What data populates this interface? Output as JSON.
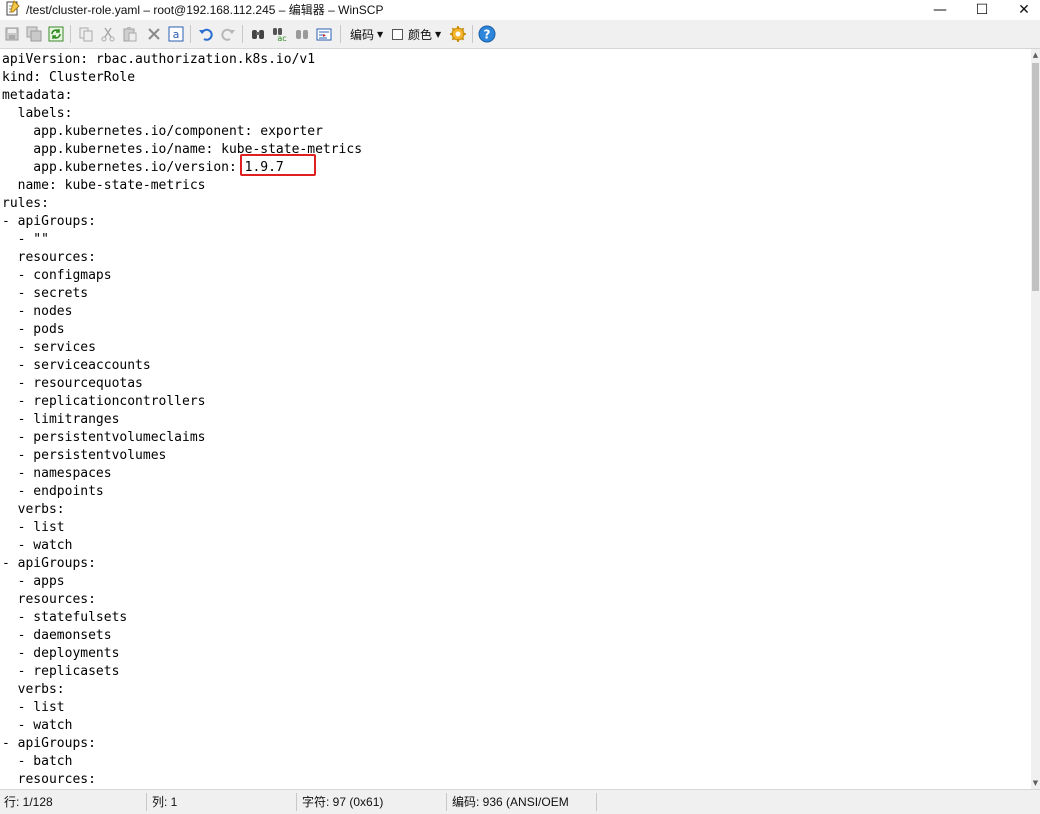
{
  "window": {
    "title": "/test/cluster-role.yaml – root@192.168.112.245 – 编辑器 – WinSCP",
    "minimize_glyph": "—",
    "maximize_glyph": "☐",
    "close_glyph": "✕"
  },
  "toolbar": {
    "encoding_label": "编码",
    "color_label": "颜色",
    "icons": [
      "save-icon",
      "save-all-icon",
      "reload-icon",
      "copy-icon",
      "cut-icon",
      "paste-icon",
      "delete-icon",
      "select-all-icon",
      "undo-icon",
      "redo-icon",
      "find-icon",
      "replace-icon",
      "find-next-icon",
      "goto-line-icon",
      "settings-icon",
      "help-icon"
    ]
  },
  "editor": {
    "lines": [
      "apiVersion: rbac.authorization.k8s.io/v1",
      "kind: ClusterRole",
      "metadata:",
      "  labels:",
      "    app.kubernetes.io/component: exporter",
      "    app.kubernetes.io/name: kube-state-metrics",
      "    app.kubernetes.io/version: 1.9.7",
      "  name: kube-state-metrics",
      "rules:",
      "- apiGroups:",
      "  - \"\"",
      "  resources:",
      "  - configmaps",
      "  - secrets",
      "  - nodes",
      "  - pods",
      "  - services",
      "  - serviceaccounts",
      "  - resourcequotas",
      "  - replicationcontrollers",
      "  - limitranges",
      "  - persistentvolumeclaims",
      "  - persistentvolumes",
      "  - namespaces",
      "  - endpoints",
      "  verbs:",
      "  - list",
      "  - watch",
      "- apiGroups:",
      "  - apps",
      "  resources:",
      "  - statefulsets",
      "  - daemonsets",
      "  - deployments",
      "  - replicasets",
      "  verbs:",
      "  - list",
      "  - watch",
      "- apiGroups:",
      "  - batch",
      "  resources:"
    ],
    "highlight_color": "#e02020"
  },
  "scrollbar": {
    "up_glyph": "▲",
    "down_glyph": "▼"
  },
  "status": {
    "line": "行: 1/128",
    "column": "列: 1",
    "char": "字符: 97 (0x61)",
    "encoding": "编码:  936   (ANSI/OEM"
  }
}
